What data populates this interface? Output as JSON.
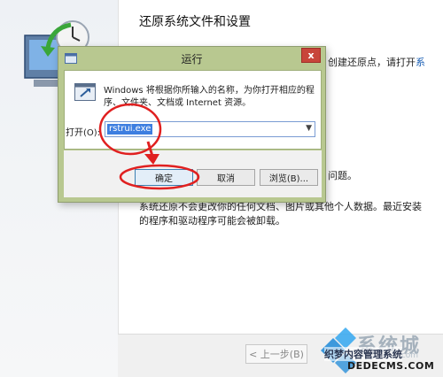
{
  "wizard": {
    "title": "还原系统文件和设置",
    "partial_line_1": "创建还原点，请打开",
    "partial_link": "系",
    "partial_line_2": "问题。",
    "note": "系统还原不会更改你的任何文档、图片或其他个人数据。最近安装的程序和驱动程序可能会被卸载。",
    "back_button": "< 上一步(B)"
  },
  "run_dialog": {
    "title": "运行",
    "close_glyph": "x",
    "description": "Windows 将根据你所输入的名称，为你打开相应的程序、文件夹、文档或 Internet 资源。",
    "open_label": "打开(O):",
    "open_value": "rstrui.exe",
    "ok_button": "确定",
    "cancel_button": "取消",
    "browse_button": "浏览(B)..."
  },
  "watermark": {
    "brand": "系统城",
    "url": "xitongcheng.com",
    "cn_text": "织梦内容管理系统",
    "site": "DEDECMS.COM"
  },
  "colors": {
    "annotation": "#e02020",
    "dialog_frame": "#b8c890",
    "selection": "#3d7ee0"
  },
  "icons": {
    "restore": "system-restore-icon",
    "run_app": "run-program-icon",
    "dropdown": "chevron-down-icon",
    "watermark": "windows-logo-icon"
  }
}
